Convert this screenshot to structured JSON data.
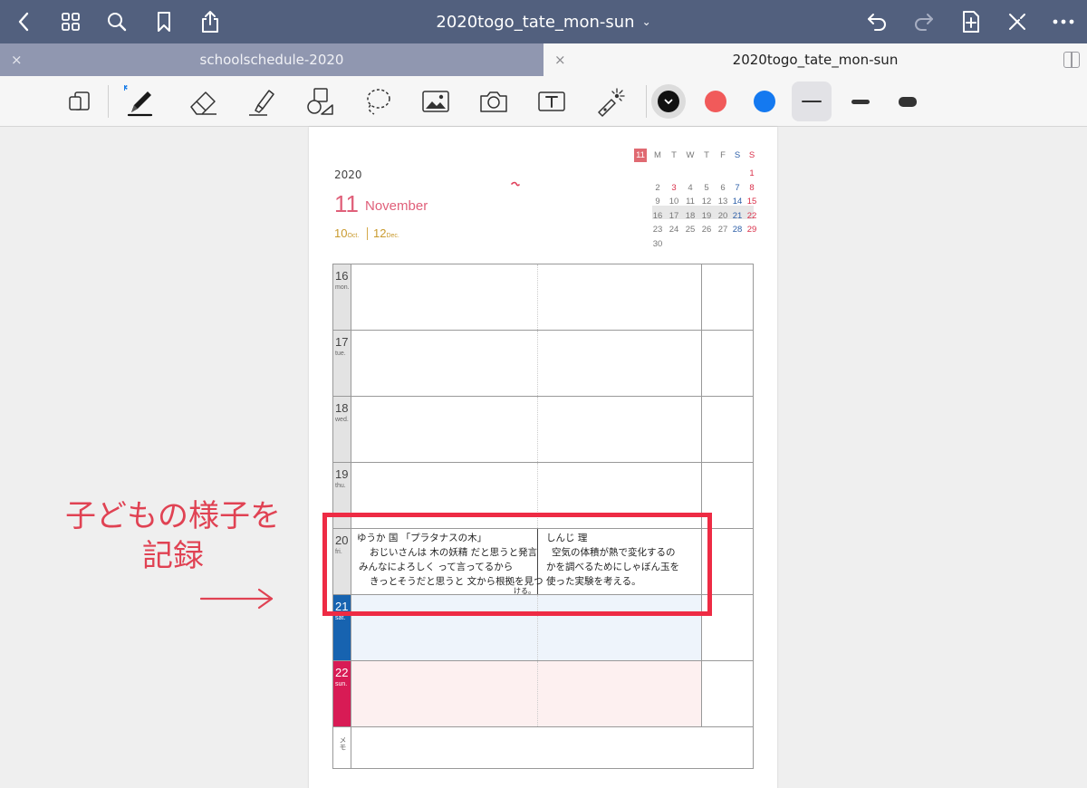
{
  "app": {
    "document_title": "2020togo_tate_mon-sun",
    "tabs": [
      {
        "label": "schoolschedule-2020",
        "close": "×",
        "active": false
      },
      {
        "label": "2020togo_tate_mon-sun",
        "close": "×",
        "active": true
      }
    ]
  },
  "toolbar": {
    "tools": [
      "page-nav-icon",
      "pen-icon",
      "eraser-icon",
      "highlighter-icon",
      "shapes-icon",
      "lasso-icon",
      "image-icon",
      "camera-icon",
      "text-icon",
      "laser-icon"
    ],
    "colors": [
      "#111111",
      "#f15a5a",
      "#1479f0"
    ],
    "selected_color_index": 0,
    "stroke_widths": [
      "thin",
      "medium",
      "thick"
    ],
    "selected_width_index": 0
  },
  "planner": {
    "year": "2020",
    "month_number": "11",
    "month_name": "November",
    "prev_month_number": "10",
    "prev_month_abbr": "Oct.",
    "next_month_number": "12",
    "next_month_abbr": "Dec.",
    "mini_calendar": {
      "header": [
        "11",
        "M",
        "T",
        "W",
        "T",
        "F",
        "S",
        "S"
      ],
      "weeks": [
        [
          "",
          "",
          "",
          "",
          "",
          "",
          "1"
        ],
        [
          "2",
          "3",
          "4",
          "5",
          "6",
          "7",
          "8"
        ],
        [
          "9",
          "10",
          "11",
          "12",
          "13",
          "14",
          "15"
        ],
        [
          "16",
          "17",
          "18",
          "19",
          "20",
          "21",
          "22"
        ],
        [
          "23",
          "24",
          "25",
          "26",
          "27",
          "28",
          "29"
        ],
        [
          "30",
          "",
          "",
          "",
          "",
          "",
          ""
        ]
      ],
      "highlighted_week_index": 3
    },
    "days": [
      {
        "num": "16",
        "name": "mon."
      },
      {
        "num": "17",
        "name": "tue."
      },
      {
        "num": "18",
        "name": "wed."
      },
      {
        "num": "19",
        "name": "thu."
      },
      {
        "num": "20",
        "name": "fri."
      },
      {
        "num": "21",
        "name": "sat."
      },
      {
        "num": "22",
        "name": "sun."
      }
    ],
    "memo_label": "メモ",
    "notes": {
      "left": [
        "ゆうか 国 「プラタナスの木」",
        "おじいさんは 木の妖精 だと思うと発言",
        "みんなによろしく って言ってるから",
        "きっとそうだと思うと 文から根拠を見つ",
        "ける。"
      ],
      "right": [
        "しんじ 理",
        "空気の体積が熱で変化するの",
        "かを調べるためにしゃぼん玉を",
        "使った実験を考える。"
      ]
    }
  },
  "annotation": {
    "text_line1": "子どもの様子を",
    "text_line2": "記録",
    "color": "#e04253"
  }
}
